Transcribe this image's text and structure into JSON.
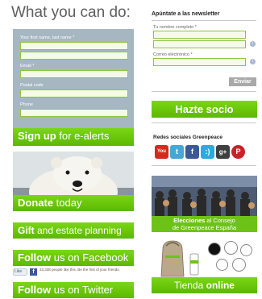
{
  "left": {
    "heading": "What you can do:",
    "form": {
      "fields": [
        {
          "label": "Your first name, last name *",
          "value": ""
        },
        {
          "label": "",
          "value": ""
        },
        {
          "label": "Email *",
          "value": ""
        },
        {
          "label": "Postal code",
          "value": ""
        },
        {
          "label": "Phone",
          "value": ""
        }
      ]
    },
    "signup": {
      "bold": "Sign up",
      "rest": " for e-alerts"
    },
    "donate": {
      "bold": "Donate",
      "rest": " today"
    },
    "gift": {
      "bold": "Gift",
      "rest": " and estate planning"
    },
    "follow_facebook": {
      "bold": "Follow",
      "rest": " us on Facebook"
    },
    "fb_like": {
      "button": "Like",
      "text": "33,338 people like this. Be the first of your friends."
    },
    "follow_twitter": {
      "bold": "Follow",
      "rest": " us on Twitter"
    }
  },
  "right": {
    "newsletter_title": "Apúntate a las newsletter",
    "fields": [
      {
        "label": "Tu nombre completo *"
      },
      {
        "label": ""
      },
      {
        "label": "Correo electrónico *"
      }
    ],
    "submit_label": "Enviar",
    "hazte_socio": "Hazte socio",
    "social_title": "Redes sociales Greenpeace",
    "social_icons": [
      {
        "name": "youtube-icon",
        "glyph": "You"
      },
      {
        "name": "twitter-icon",
        "glyph": "t"
      },
      {
        "name": "facebook-icon",
        "glyph": "f"
      },
      {
        "name": "hi5-icon",
        "glyph": ":)"
      },
      {
        "name": "google-plus-icon",
        "glyph": "g+"
      },
      {
        "name": "pinterest-icon",
        "glyph": "P"
      }
    ],
    "elecciones": {
      "bold": "Elecciones",
      "line1_rest": " al Consejo",
      "line2": "de Greenpeace España"
    },
    "tienda": {
      "normal": "Tienda ",
      "bold": "online"
    }
  },
  "colors": {
    "accent_green": "#66cc00",
    "form_panel": "#a6b7c2",
    "facebook_blue": "#3b5998"
  }
}
